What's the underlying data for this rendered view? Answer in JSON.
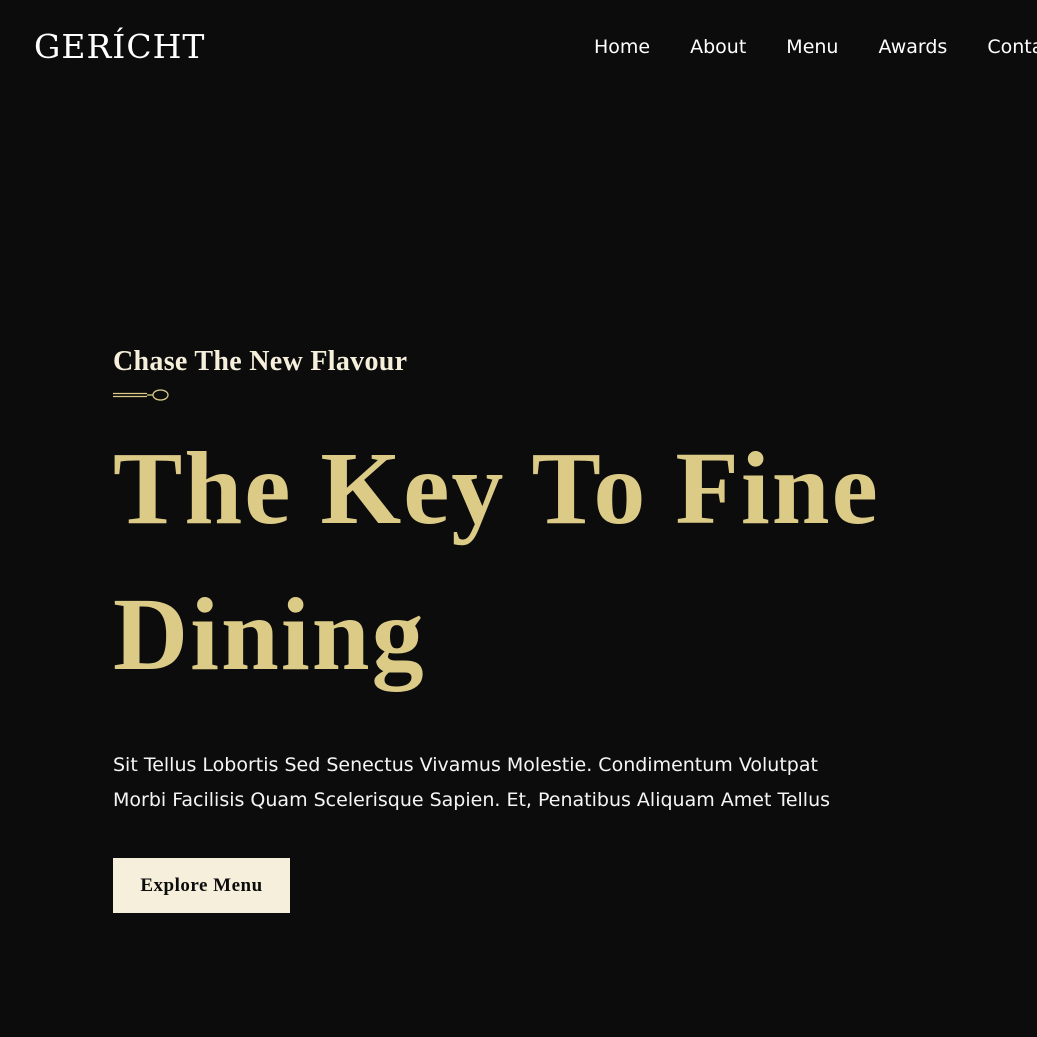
{
  "brand": {
    "logo_text": "GERÍCHT"
  },
  "nav": {
    "items": [
      {
        "label": "Home"
      },
      {
        "label": "About"
      },
      {
        "label": "Menu"
      },
      {
        "label": "Awards"
      },
      {
        "label": "Contact"
      }
    ]
  },
  "hero": {
    "subtitle": "Chase The New Flavour",
    "title_line1": "The Key To Fine",
    "title_line2": "Dining",
    "description_line1": "Sit Tellus Lobortis Sed Senectus Vivamus Molestie. Condimentum Volutpat",
    "description_line2": "Morbi Facilisis Quam Scelerisque Sapien. Et, Penatibus Aliquam Amet Tellus",
    "cta_label": "Explore Menu"
  },
  "colors": {
    "background": "#0c0c0c",
    "accent_gold": "#dcca87",
    "cream": "#f5efdb",
    "text_white": "#ffffff"
  },
  "icons": {
    "divider": "spoon-icon"
  }
}
